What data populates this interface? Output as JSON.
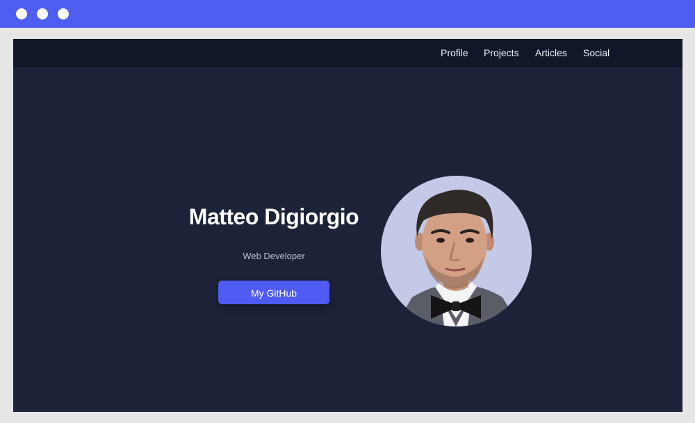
{
  "browser": {
    "dots": [
      "window-dot",
      "window-dot",
      "window-dot"
    ]
  },
  "nav": {
    "items": [
      {
        "label": "Profile"
      },
      {
        "label": "Projects"
      },
      {
        "label": "Articles"
      },
      {
        "label": "Social"
      }
    ]
  },
  "hero": {
    "name": "Matteo Digiorgio",
    "subtitle": "Web Developer",
    "cta_label": "My GitHub"
  },
  "colors": {
    "browser_bar": "#4e5ef3",
    "page_background": "#1c2339",
    "nav_background": "#111728",
    "accent": "#4f5bf2",
    "avatar_background": "#c3c9e6"
  }
}
